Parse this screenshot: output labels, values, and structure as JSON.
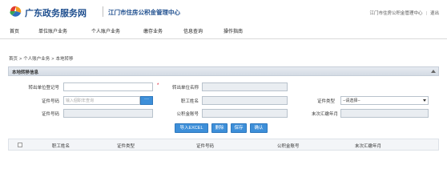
{
  "header": {
    "brand": "广东政务服务网",
    "center_name": "江门市住房公积金管理中心",
    "user_link": "江门市住房公积金管理中心",
    "logout": "退出",
    "divider": "|"
  },
  "nav": {
    "items": [
      "首页",
      "单位账户业务",
      "个人账户业务",
      "缴存业务",
      "信息查询",
      "操作指南"
    ]
  },
  "breadcrumb": [
    "首页",
    "个人账户业务",
    "本地转移"
  ],
  "breadcrumb_sep": ">",
  "panel": {
    "title": "本地转移信息"
  },
  "form": {
    "out_reg_no_label": "转出单位登记号",
    "out_reg_no_value": "",
    "required_mark": "*",
    "out_unit_name_label": "转出单位名称",
    "cert_no_label": "证件号码",
    "cert_no_placeholder": "输入個职年查询",
    "lookup_button": "···",
    "worker_name_label": "职工姓名",
    "cert_type_label": "证件类型",
    "cert_type_selected": "--请选择--",
    "cert_no2_label": "证件号码",
    "fund_account_label": "公积金账号",
    "last_month_label": "末次汇缴年月"
  },
  "buttons": {
    "import": "导入EXCEL",
    "delete": "删除",
    "save": "保存",
    "confirm": "确认"
  },
  "table": {
    "columns": [
      "职工姓名",
      "证件类型",
      "证件号码",
      "公积金账号",
      "末次汇缴年月"
    ]
  },
  "colors": {
    "brand": "#1f4f8f",
    "button": "#3d8fd9",
    "required": "#d9001b"
  }
}
